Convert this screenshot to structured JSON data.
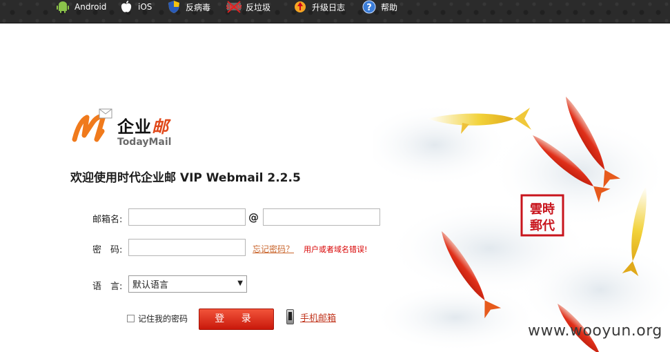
{
  "topbar": {
    "items": [
      {
        "icon": "android-icon",
        "label": "Android"
      },
      {
        "icon": "apple-icon",
        "label": "iOS"
      },
      {
        "icon": "shield-icon",
        "label": "反病毒"
      },
      {
        "icon": "spam-icon",
        "label": "反垃圾"
      },
      {
        "icon": "upgrade-icon",
        "label": "升级日志"
      },
      {
        "icon": "help-icon",
        "label": "帮助"
      }
    ]
  },
  "logo": {
    "cn_dark": "企业",
    "cn_red": "邮",
    "en": "TodayMail"
  },
  "welcome": "欢迎使用时代企业邮 VIP Webmail 2.2.5",
  "form": {
    "mailbox_label": "邮箱名:",
    "at": "@",
    "mailbox_value": "",
    "domain_value": "",
    "password_label": "密　码:",
    "password_value": "",
    "forgot": "忘记密码？",
    "error": "用户或者域名错误!",
    "language_label": "语　言:",
    "language_selected": "默认语言",
    "remember": "记住我的密码",
    "login": "登 录",
    "mobile": "手机邮箱"
  },
  "art": {
    "seal_text": "雲郵時代"
  },
  "watermark": "www.wooyun.org",
  "colors": {
    "accent": "#e0481a",
    "button": "#d9230f",
    "link": "#c9652c",
    "error": "#d80000"
  }
}
